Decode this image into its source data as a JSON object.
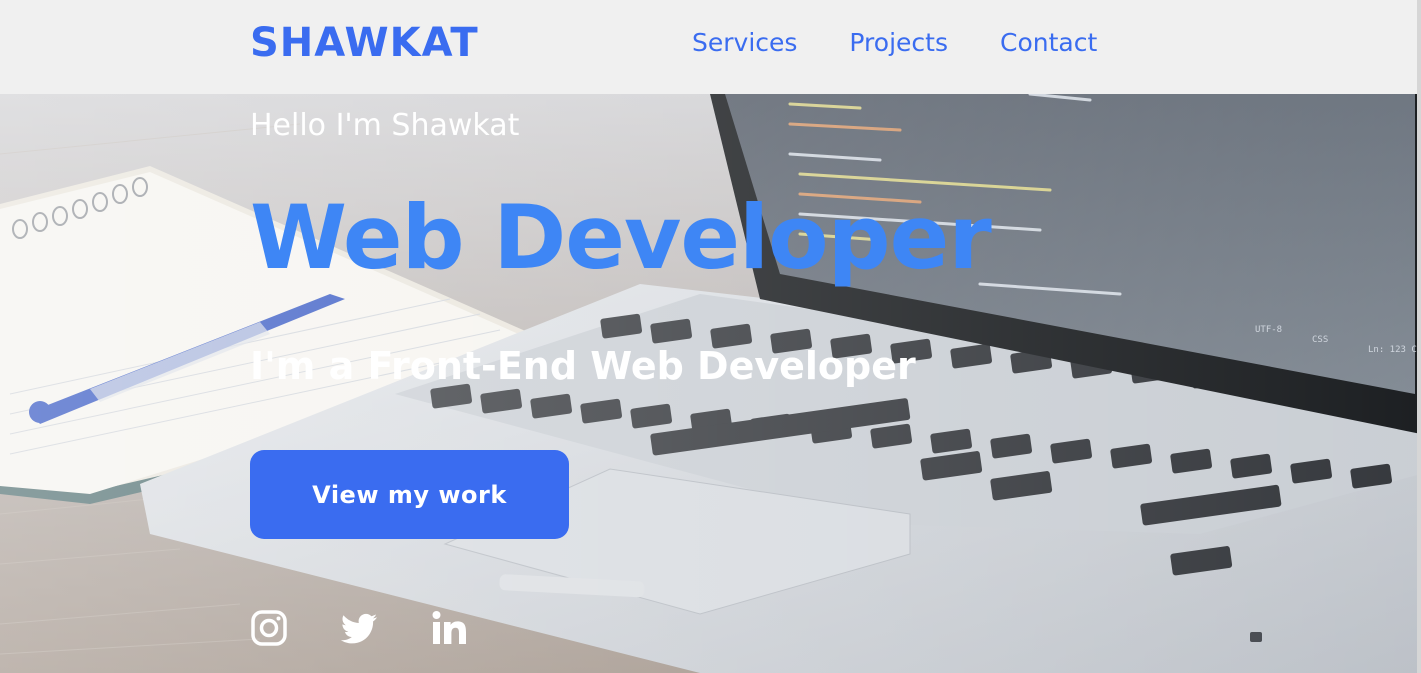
{
  "header": {
    "logo": "SHAWKAT",
    "nav": [
      {
        "label": "Services"
      },
      {
        "label": "Projects"
      },
      {
        "label": "Contact"
      }
    ]
  },
  "hero": {
    "greeting": "Hello I'm Shawkat",
    "title": "Web Developer",
    "subtitle": "I'm a Front-End Web Developer",
    "cta_label": "View my work",
    "background_image": "laptop-notebook-pen-desk-photo"
  },
  "socials": [
    {
      "icon": "instagram-icon"
    },
    {
      "icon": "twitter-icon"
    },
    {
      "icon": "linkedin-icon"
    }
  ],
  "colors": {
    "accent": "#3a6cf0",
    "title_blue": "#3e86f5",
    "header_bg": "#f0f0f0"
  }
}
